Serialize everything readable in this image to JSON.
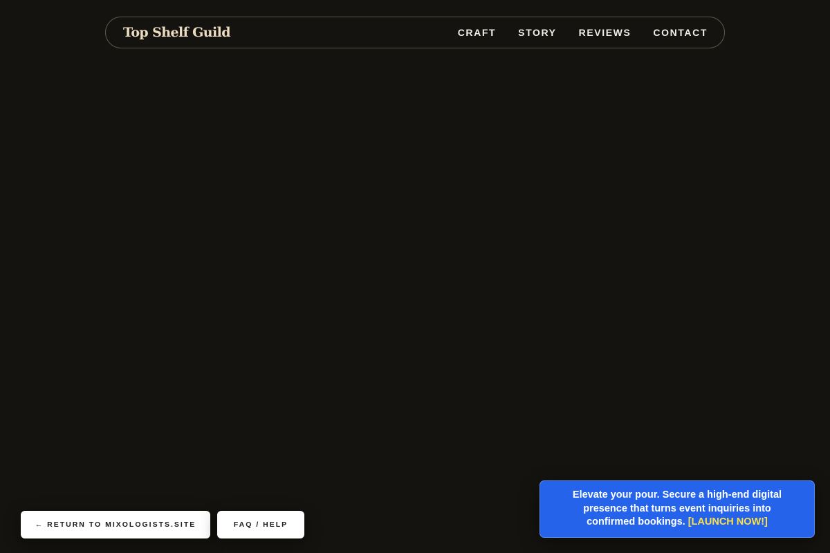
{
  "brand": {
    "name": "Top Shelf Guild"
  },
  "nav": {
    "items": [
      {
        "label": "CRAFT"
      },
      {
        "label": "STORY"
      },
      {
        "label": "REVIEWS"
      },
      {
        "label": "CONTACT"
      }
    ]
  },
  "footer_buttons": {
    "return_label": "← RETURN TO MIXOLOGISTS.SITE",
    "faq_label": "FAQ / HELP"
  },
  "promo": {
    "text": "Elevate your pour. Secure a high-end digital presence that turns event inquiries into confirmed bookings.",
    "cta": "[LAUNCH NOW!]",
    "background_color": "#2563eb",
    "cta_color": "#fde047"
  },
  "theme": {
    "page_background": "#15130f",
    "brand_color": "#ecdcc0"
  }
}
